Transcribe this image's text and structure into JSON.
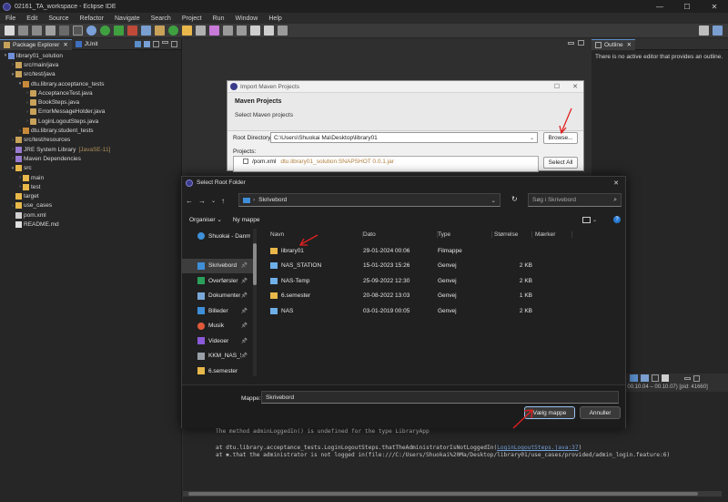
{
  "window": {
    "title": "02161_TA_workspace - Eclipse IDE",
    "controls": [
      "—",
      "☐",
      "✕"
    ]
  },
  "menu": [
    "File",
    "Edit",
    "Source",
    "Refactor",
    "Navigate",
    "Search",
    "Project",
    "Run",
    "Window",
    "Help"
  ],
  "explorer": {
    "tabs": [
      "Package Explorer",
      "JUnit"
    ],
    "tree": [
      {
        "label": "library01_solution",
        "indent": 0,
        "arrow": "▾",
        "icon": "project-icon"
      },
      {
        "label": "src/main/java",
        "indent": 1,
        "arrow": "›",
        "icon": "source-folder-icon"
      },
      {
        "label": "src/test/java",
        "indent": 1,
        "arrow": "▾",
        "icon": "source-folder-icon"
      },
      {
        "label": "dtu.library.acceptance_tests",
        "indent": 2,
        "arrow": "▾",
        "icon": "package-icon"
      },
      {
        "label": "AcceptanceTest.java",
        "indent": 3,
        "arrow": "›",
        "icon": "java-file-icon"
      },
      {
        "label": "BookSteps.java",
        "indent": 3,
        "arrow": "›",
        "icon": "java-file-icon"
      },
      {
        "label": "ErrorMessageHolder.java",
        "indent": 3,
        "arrow": "›",
        "icon": "java-file-icon"
      },
      {
        "label": "LoginLogoutSteps.java",
        "indent": 3,
        "arrow": "›",
        "icon": "java-file-icon"
      },
      {
        "label": "dtu.library.student_tests",
        "indent": 2,
        "arrow": "›",
        "icon": "package-icon"
      },
      {
        "label": "src/test/resources",
        "indent": 1,
        "arrow": "›",
        "icon": "source-folder-icon"
      },
      {
        "label": "JRE System Library",
        "suffix": "[JavaSE-11]",
        "indent": 1,
        "arrow": "›",
        "icon": "library-icon"
      },
      {
        "label": "Maven Dependencies",
        "indent": 1,
        "arrow": "›",
        "icon": "library-icon"
      },
      {
        "label": "src",
        "indent": 1,
        "arrow": "▾",
        "icon": "folder-icon"
      },
      {
        "label": "main",
        "indent": 2,
        "arrow": "›",
        "icon": "folder-icon"
      },
      {
        "label": "test",
        "indent": 2,
        "arrow": "›",
        "icon": "folder-icon"
      },
      {
        "label": "target",
        "indent": 1,
        "arrow": "",
        "icon": "folder-icon"
      },
      {
        "label": "use_cases",
        "indent": 1,
        "arrow": "›",
        "icon": "folder-icon"
      },
      {
        "label": "pom.xml",
        "indent": 1,
        "arrow": "",
        "icon": "xml-file-icon"
      },
      {
        "label": "README.md",
        "indent": 1,
        "arrow": "",
        "icon": "text-file-icon"
      }
    ]
  },
  "outline": {
    "tab": "Outline",
    "message": "There is no active editor that provides an outline."
  },
  "console": {
    "header_text": "ration: 2024 00.10.04 – 00.10.07) [pid: 41660]",
    "lines": [
      "The method adminLoggedIn() is undefined for the type LibraryApp",
      "at dtu.library.acceptance_tests.LoginLogoutSteps.thatTheAdministratorIsNotLoggedIn(",
      "at ✱.that the administrator is not logged in(file:///C:/Users/Shuokai%20Ma/Desktop/library01/use_cases/provided/admin_login.feature:6)"
    ],
    "link_text": "LoginLogoutSteps.java:37",
    "link_tail": ")"
  },
  "maven": {
    "title": "Import Maven Projects",
    "heading": "Maven Projects",
    "subheading": "Select Maven projects",
    "root_label": "Root Directory:",
    "root_value": "C:\\Users\\Shuokai Ma\\Desktop\\library01",
    "browse_label": "Browse...",
    "projects_label": "Projects:",
    "project_item": "/pom.xml",
    "project_suffix": "dtu.library01_solution:SNAPSHOT 0.0.1.jar",
    "select_all_label": "Select All"
  },
  "folder": {
    "title": "Select Root Folder",
    "breadcrumb": "Skrivebord",
    "search_placeholder": "Søg i Skrivebord",
    "organize_label": "Organiser",
    "new_folder_label": "Ny mappe",
    "nav": [
      {
        "label": "Shuokai - Danm",
        "icon": "cloud-icon",
        "pinned": false
      },
      {
        "label": "Skrivebord",
        "icon": "desktop-icon",
        "pinned": true,
        "selected": true
      },
      {
        "label": "Overførsler",
        "icon": "download-icon",
        "pinned": true
      },
      {
        "label": "Dokumenter",
        "icon": "documents-icon",
        "pinned": true
      },
      {
        "label": "Billeder",
        "icon": "pictures-icon",
        "pinned": true
      },
      {
        "label": "Musik",
        "icon": "music-icon",
        "pinned": true
      },
      {
        "label": "Videoer",
        "icon": "videos-icon",
        "pinned": true
      },
      {
        "label": "KKM_NAS_ST",
        "icon": "network-drive-icon",
        "pinned": true
      },
      {
        "label": "6.semester",
        "icon": "folder-icon",
        "pinned": false
      }
    ],
    "columns": [
      "Navn",
      "Dato",
      "Type",
      "Størrelse",
      "Mærker"
    ],
    "files": [
      {
        "name": "library01",
        "date": "29-01-2024 00:06",
        "type": "Filmappe",
        "size": "",
        "icon": "folder-icon"
      },
      {
        "name": "NAS_STATION",
        "date": "15-01-2023 15:26",
        "type": "Genvej",
        "size": "2 KB",
        "icon": "shortcut-icon"
      },
      {
        "name": "NAS-Temp",
        "date": "25-09-2022 12:30",
        "type": "Genvej",
        "size": "2 KB",
        "icon": "shortcut-icon"
      },
      {
        "name": "6.semester",
        "date": "20-08-2022 13:03",
        "type": "Genvej",
        "size": "1 KB",
        "icon": "folder-shortcut-icon"
      },
      {
        "name": "NAS",
        "date": "03-01-2019 00:05",
        "type": "Genvej",
        "size": "2 KB",
        "icon": "shortcut-icon"
      }
    ],
    "folder_label": "Mappe:",
    "folder_value": "Skrivebord",
    "select_button": "Vælg mappe",
    "cancel_button": "Annuller"
  },
  "colors": {
    "accent": "#5a8dc9",
    "annotation_arrow": "#e02020",
    "folder_yellow": "#e8b84a",
    "java_icon": "#c9a25a"
  }
}
